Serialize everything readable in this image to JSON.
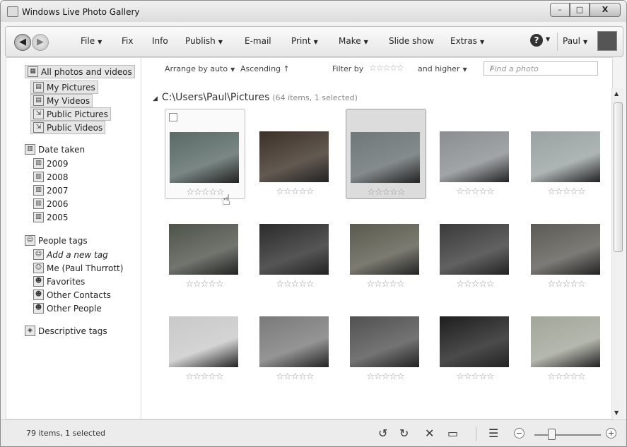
{
  "window": {
    "title": "Windows Live Photo Gallery",
    "minimize": "–",
    "maximize": "□",
    "close": "X"
  },
  "toolbar": {
    "file": "File",
    "fix": "Fix",
    "info": "Info",
    "publish": "Publish",
    "email": "E-mail",
    "print": "Print",
    "make": "Make",
    "slideshow": "Slide show",
    "extras": "Extras",
    "help": "?",
    "user": "Paul"
  },
  "sidebar": {
    "all": "All photos and videos",
    "my_pictures": "My Pictures",
    "my_videos": "My Videos",
    "public_pictures": "Public Pictures",
    "public_videos": "Public Videos",
    "date_taken": "Date taken",
    "years": [
      "2009",
      "2008",
      "2007",
      "2006",
      "2005"
    ],
    "people_tags": "People tags",
    "add_tag": "Add a new tag",
    "me": "Me (Paul Thurrott)",
    "favorites": "Favorites",
    "other_contacts": "Other Contacts",
    "other_people": "Other People",
    "descriptive_tags": "Descriptive tags"
  },
  "filter": {
    "arrange": "Arrange by auto",
    "ascending": "Ascending",
    "filter_by": "Filter by",
    "stars": "☆☆☆☆☆",
    "and_higher": "and higher",
    "search_placeholder": "Find a photo"
  },
  "gallery": {
    "path": "C:\\Users\\Paul\\Pictures",
    "meta": "(64 items, 1 selected)",
    "rating": "☆☆☆☆☆",
    "photo_colors": [
      "#5a6a66",
      "#3b3026",
      "#6f7779",
      "#8a8e91",
      "#9aa2a2",
      "#4e534a",
      "#2b2b2b",
      "#5a5a4e",
      "#3a3a3a",
      "#5c5a54",
      "#c9c9c9",
      "#7a7a7a",
      "#515151",
      "#1e1e1e",
      "#a3a69a"
    ]
  },
  "status": {
    "text": "79 items, 1 selected",
    "zoom_level": 0.25
  }
}
